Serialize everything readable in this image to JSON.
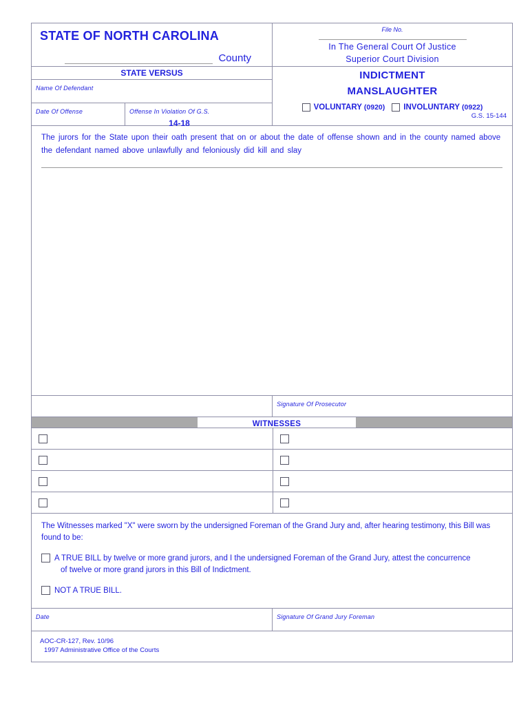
{
  "header": {
    "state_title": "STATE OF NORTH CAROLINA",
    "county_label": "County",
    "file_no_label": "File No.",
    "court_line1": "In The General Court Of Justice",
    "court_line2": "Superior Court Division"
  },
  "case": {
    "state_versus": "STATE VERSUS",
    "name_of_defendant_label": "Name Of Defendant",
    "date_of_offense_label": "Date Of Offense",
    "offense_in_violation_label": "Offense In Violation Of G.S.",
    "gs_number": "14-18"
  },
  "indictment": {
    "title_line1": "INDICTMENT",
    "title_line2": "MANSLAUGHTER",
    "voluntary_label": "VOLUNTARY",
    "voluntary_code": "(0920)",
    "involuntary_label": "INVOLUNTARY",
    "involuntary_code": "(0922)",
    "gs_reference": "G.S. 15-144"
  },
  "body": {
    "charge_text": "The jurors for the State upon their oath present that on or about the date of offense shown and in the county named above the defendant named above unlawfully  and feloniously  did kill and slay"
  },
  "prosecutor": {
    "signature_label": "Signature Of Prosecutor"
  },
  "witnesses": {
    "bar_label": "WITNESSES",
    "rows": [
      {
        "left": "",
        "right": ""
      },
      {
        "left": "",
        "right": ""
      },
      {
        "left": "",
        "right": ""
      },
      {
        "left": "",
        "right": ""
      }
    ]
  },
  "findings": {
    "intro_text": "The Witnesses marked \"X\" were sworn by the undersigned Foreman of the Grand Jury and, after hearing testimony, this Bill was found to be:",
    "true_bill_line1": "A TRUE BILL by twelve or more grand jurors, and I the undersigned Foreman of the Grand Jury, attest the concurrence",
    "true_bill_line2": "of twelve or more grand jurors in this Bill of Indictment.",
    "not_true_bill": "NOT A TRUE BILL."
  },
  "footer": {
    "date_label": "Date",
    "foreman_signature_label": "Signature Of Grand Jury Foreman",
    "form_number": "AOC-CR-127, Rev. 10/96",
    "copyright_line": "1997 Administrative Office of the Courts"
  },
  "colors": {
    "ink": "#2222dd",
    "rule": "#8f8fa8",
    "gray_bar": "#a9a9a9"
  }
}
